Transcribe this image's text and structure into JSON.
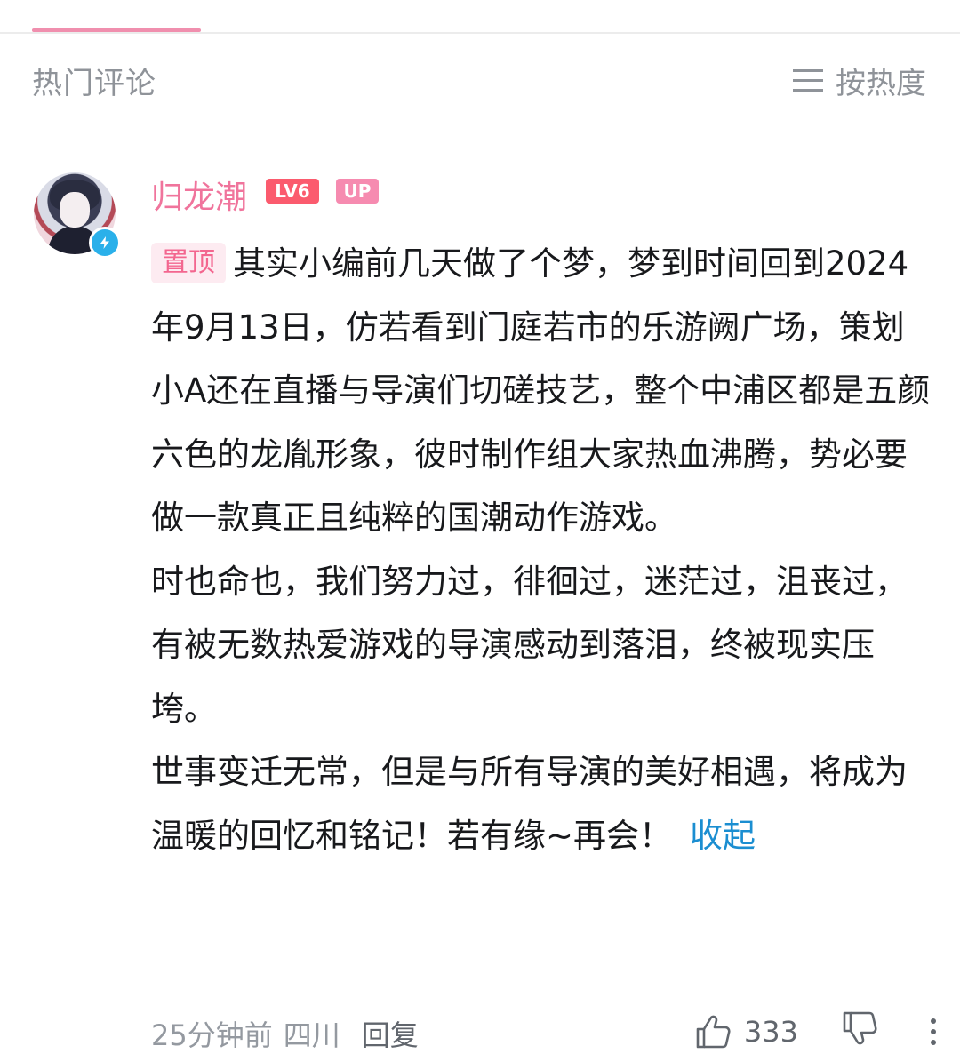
{
  "header": {
    "section_title": "热门评论",
    "sort_label": "按热度"
  },
  "comment": {
    "username": "归龙潮",
    "level_badge": "LV6",
    "up_badge": "UP",
    "pinned_label": "置顶",
    "paragraphs": [
      "其实小编前几天做了个梦，梦到时间回到2024年9月13日，仿若看到门庭若市的乐游阙广场，策划小A还在直播与导演们切磋技艺，整个中浦区都是五颜六色的龙胤形象，彼时制作组大家热血沸腾，势必要做一款真正且纯粹的国潮动作游戏。",
      "时也命也，我们努力过，徘徊过，迷茫过，沮丧过，有被无数热爱游戏的导演感动到落泪，终被现实压垮。",
      "世事变迁无常，但是与所有导演的美好相遇，将成为温暖的回忆和铭记！若有缘~再会！"
    ],
    "collapse_label": "收起",
    "time": "25分钟前",
    "region": "四川",
    "reply_label": "回复",
    "like_count": "333"
  },
  "colors": {
    "accent_pink": "#f0749c",
    "link_blue": "#1b8ed1",
    "verify_blue": "#2ab0ea"
  }
}
